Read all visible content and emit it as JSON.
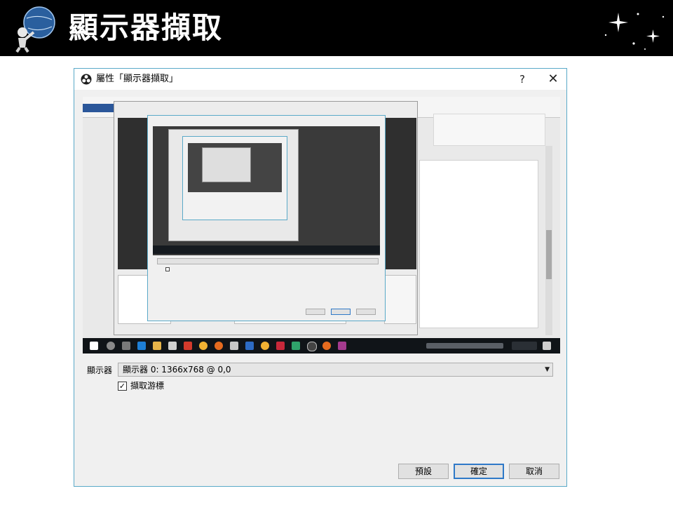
{
  "slide": {
    "title": "顯示器擷取"
  },
  "dialog": {
    "title": "屬性「顯示器擷取」",
    "help_symbol": "?",
    "close_symbol": "✕",
    "display_label": "顯示器",
    "display_value": "顯示器 0: 1366x768 @ 0,0",
    "dropdown_arrow": "▼",
    "capture_cursor_label": "擷取游標",
    "capture_cursor_checked": true,
    "checkmark": "✓",
    "buttons": {
      "defaults": "預設",
      "ok": "確定",
      "cancel": "取消"
    }
  },
  "colors": {
    "header_bg": "#000000",
    "dialog_border": "#5aa9c8",
    "primary_button_border": "#2f79c8",
    "preview_bg": "#3a3a3a"
  },
  "icons": [
    "obs-logo-icon",
    "help-icon",
    "close-icon",
    "dropdown-arrow-icon",
    "checkmark-icon",
    "sparkle-decoration-icon"
  ]
}
